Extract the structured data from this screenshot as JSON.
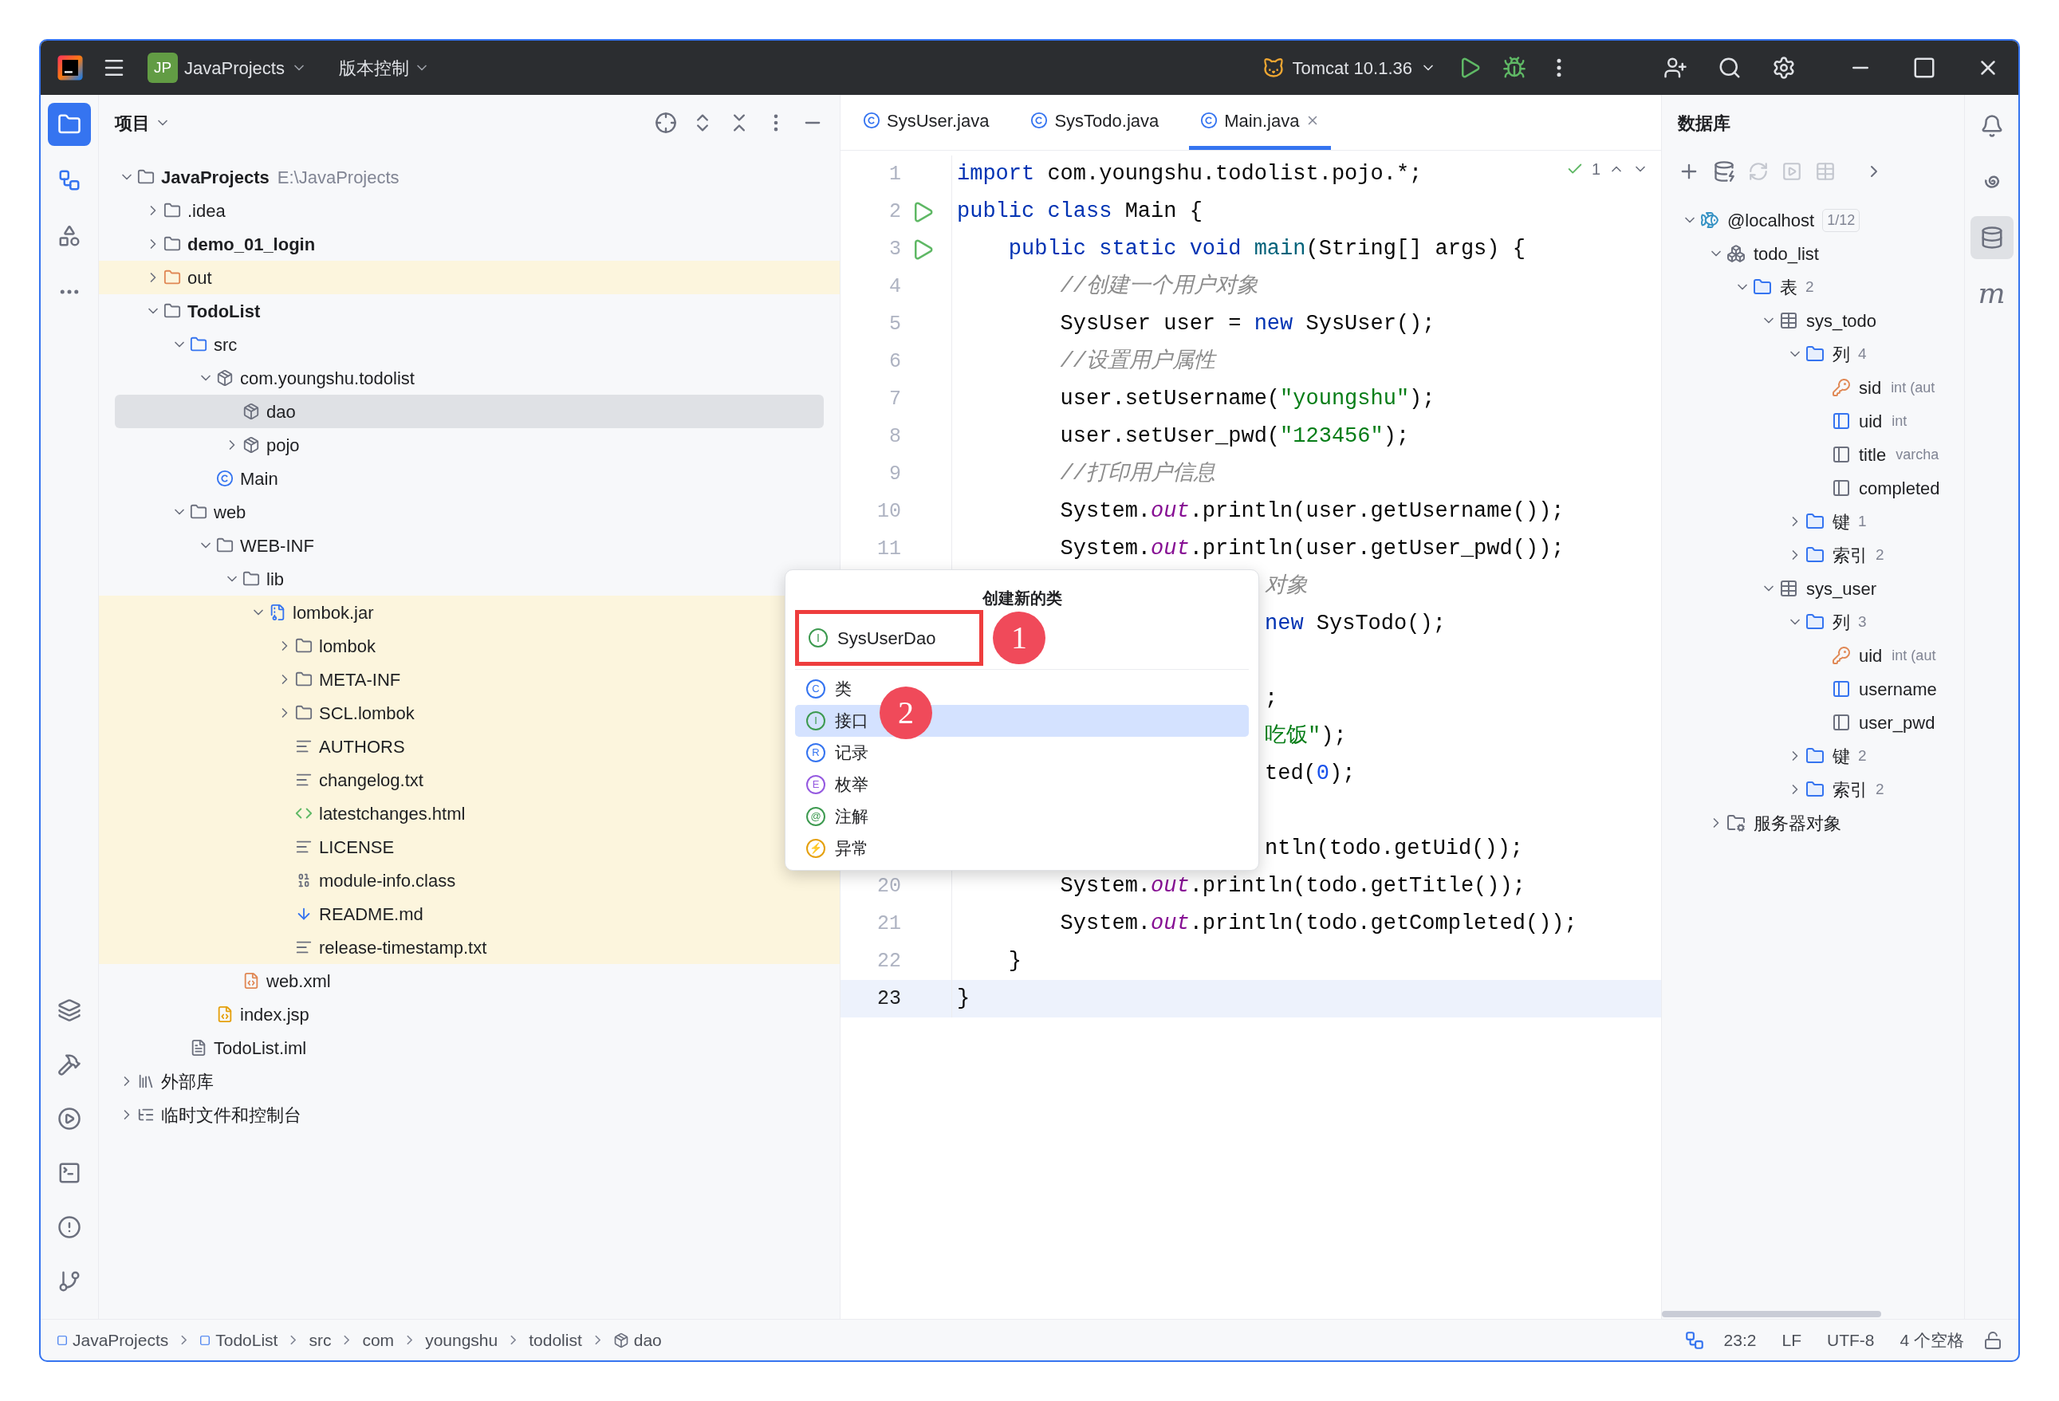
{
  "title_bar": {
    "project_badge": "JP",
    "project": "JavaProjects",
    "vcs": "版本控制",
    "run_config": "Tomcat 10.1.36"
  },
  "project_panel": {
    "title": "项目",
    "tree": [
      {
        "name": "JavaProjects",
        "path": "E:\\JavaProjects",
        "kind": "module",
        "expanded": true,
        "selected": false,
        "highlighted": false,
        "children": [
          {
            "name": ".idea",
            "kind": "folder",
            "expanded": false,
            "selected": false,
            "highlighted": false
          },
          {
            "name": "demo_01_login",
            "kind": "module",
            "expanded": false,
            "selected": false,
            "highlighted": false
          },
          {
            "name": "out",
            "kind": "excluded",
            "expanded": false,
            "selected": false,
            "highlighted": true
          },
          {
            "name": "TodoList",
            "kind": "module",
            "expanded": true,
            "selected": false,
            "highlighted": false,
            "children": [
              {
                "name": "src",
                "kind": "source",
                "expanded": true,
                "selected": false,
                "highlighted": false,
                "children": [
                  {
                    "name": "com.youngshu.todolist",
                    "kind": "package",
                    "expanded": true,
                    "selected": false,
                    "highlighted": false,
                    "children": [
                      {
                        "name": "dao",
                        "kind": "package",
                        "selected": true,
                        "highlighted": false
                      },
                      {
                        "name": "pojo",
                        "kind": "package",
                        "expanded": false,
                        "selected": false,
                        "highlighted": false
                      }
                    ]
                  },
                  {
                    "name": "Main",
                    "kind": "class",
                    "selected": false,
                    "highlighted": false
                  }
                ]
              },
              {
                "name": "web",
                "kind": "folder",
                "expanded": true,
                "selected": false,
                "highlighted": false,
                "children": [
                  {
                    "name": "WEB-INF",
                    "kind": "folder",
                    "expanded": true,
                    "selected": false,
                    "highlighted": false,
                    "children": [
                      {
                        "name": "lib",
                        "kind": "folder",
                        "expanded": true,
                        "selected": false,
                        "highlighted": false,
                        "children": [
                          {
                            "name": "lombok.jar",
                            "kind": "jar",
                            "expanded": true,
                            "selected": false,
                            "highlighted": true,
                            "children": [
                              {
                                "name": "lombok",
                                "kind": "folder",
                                "expanded": false,
                                "selected": false,
                                "highlighted": true
                              },
                              {
                                "name": "META-INF",
                                "kind": "folder",
                                "expanded": false,
                                "selected": false,
                                "highlighted": true
                              },
                              {
                                "name": "SCL.lombok",
                                "kind": "folder",
                                "expanded": false,
                                "selected": false,
                                "highlighted": true
                              },
                              {
                                "name": "AUTHORS",
                                "kind": "text",
                                "selected": false,
                                "highlighted": true
                              },
                              {
                                "name": "changelog.txt",
                                "kind": "text",
                                "selected": false,
                                "highlighted": true
                              },
                              {
                                "name": "latestchanges.html",
                                "kind": "html",
                                "selected": false,
                                "highlighted": true
                              },
                              {
                                "name": "LICENSE",
                                "kind": "text",
                                "selected": false,
                                "highlighted": true
                              },
                              {
                                "name": "module-info.class",
                                "kind": "binary",
                                "selected": false,
                                "highlighted": true
                              },
                              {
                                "name": "README.md",
                                "kind": "markdown",
                                "selected": false,
                                "highlighted": true
                              },
                              {
                                "name": "release-timestamp.txt",
                                "kind": "text",
                                "selected": false,
                                "highlighted": true
                              }
                            ]
                          }
                        ]
                      },
                      {
                        "name": "web.xml",
                        "kind": "xml",
                        "selected": false,
                        "highlighted": false
                      }
                    ]
                  },
                  {
                    "name": "index.jsp",
                    "kind": "jsp",
                    "selected": false,
                    "highlighted": false
                  }
                ]
              },
              {
                "name": "TodoList.iml",
                "kind": "iml",
                "selected": false,
                "highlighted": false
              }
            ]
          }
        ]
      },
      {
        "name": "外部库",
        "kind": "library",
        "expanded": false,
        "selected": false,
        "highlighted": false
      },
      {
        "name": "临时文件和控制台",
        "kind": "scratch",
        "expanded": false,
        "selected": false,
        "highlighted": false
      }
    ]
  },
  "editor": {
    "tabs": [
      {
        "label": "SysUser.java",
        "selected": false
      },
      {
        "label": "SysTodo.java",
        "selected": false
      },
      {
        "label": "Main.java",
        "selected": true
      }
    ],
    "inspection_count": "1",
    "lines": [
      {
        "kind": "full",
        "number": "1",
        "runnable": false,
        "current": false,
        "tokens": [
          {
            "kind": "kw",
            "text": "import"
          },
          {
            "kind": "plain",
            "text": " com.youngshu.todolist.pojo.*;"
          }
        ]
      },
      {
        "kind": "full",
        "number": "2",
        "runnable": true,
        "current": false,
        "tokens": [
          {
            "kind": "kw",
            "text": "public class"
          },
          {
            "kind": "plain",
            "text": " Main {"
          }
        ]
      },
      {
        "kind": "full",
        "number": "3",
        "runnable": true,
        "current": false,
        "tokens": [
          {
            "kind": "kw",
            "text": "    public static void"
          },
          {
            "kind": "method",
            "text": " main"
          },
          {
            "kind": "plain",
            "text": "(String[] args) {"
          }
        ]
      },
      {
        "kind": "full",
        "number": "4",
        "runnable": false,
        "current": false,
        "tokens": [
          {
            "kind": "comment",
            "text": "        //创建一个用户对象"
          }
        ]
      },
      {
        "kind": "full",
        "number": "5",
        "runnable": false,
        "current": false,
        "tokens": [
          {
            "kind": "plain",
            "text": "        SysUser user = "
          },
          {
            "kind": "kw",
            "text": "new"
          },
          {
            "kind": "plain",
            "text": " SysUser();"
          }
        ]
      },
      {
        "kind": "full",
        "number": "6",
        "runnable": false,
        "current": false,
        "tokens": [
          {
            "kind": "comment",
            "text": "        //设置用户属性"
          }
        ]
      },
      {
        "kind": "full",
        "number": "7",
        "runnable": false,
        "current": false,
        "tokens": [
          {
            "kind": "plain",
            "text": "        user.setUsername("
          },
          {
            "kind": "str",
            "text": "\"youngshu\""
          },
          {
            "kind": "plain",
            "text": ");"
          }
        ]
      },
      {
        "kind": "full",
        "number": "8",
        "runnable": false,
        "current": false,
        "tokens": [
          {
            "kind": "plain",
            "text": "        user.setUser_pwd("
          },
          {
            "kind": "str",
            "text": "\"123456\""
          },
          {
            "kind": "plain",
            "text": ");"
          }
        ]
      },
      {
        "kind": "full",
        "number": "9",
        "runnable": false,
        "current": false,
        "tokens": [
          {
            "kind": "comment",
            "text": "        //打印用户信息"
          }
        ]
      },
      {
        "kind": "full",
        "number": "10",
        "runnable": false,
        "current": false,
        "tokens": [
          {
            "kind": "plain",
            "text": "        System."
          },
          {
            "kind": "field",
            "text": "out"
          },
          {
            "kind": "plain",
            "text": ".println(user.getUsername());"
          }
        ]
      },
      {
        "kind": "full",
        "number": "11",
        "runnable": false,
        "current": false,
        "tokens": [
          {
            "kind": "plain",
            "text": "        System."
          },
          {
            "kind": "field",
            "text": "out"
          },
          {
            "kind": "plain",
            "text": ".println(user.getUser_pwd());"
          }
        ]
      },
      {
        "kind": "partial",
        "tokens": [
          {
            "kind": "comment",
            "text": "对象"
          }
        ]
      },
      {
        "kind": "partial",
        "tokens": [
          {
            "kind": "kw",
            "text": "new"
          },
          {
            "kind": "plain",
            "text": " SysTodo();"
          }
        ]
      },
      {
        "kind": "partial"
      },
      {
        "kind": "partial",
        "tokens": [
          {
            "kind": "plain",
            "text": ";"
          }
        ]
      },
      {
        "kind": "partial",
        "tokens": [
          {
            "kind": "str",
            "text": "吃饭\""
          },
          {
            "kind": "plain",
            "text": ");"
          }
        ]
      },
      {
        "kind": "partial",
        "tokens": [
          {
            "kind": "plain",
            "text": "ted("
          },
          {
            "kind": "num",
            "text": "0"
          },
          {
            "kind": "plain",
            "text": ");"
          }
        ]
      },
      {
        "kind": "partial"
      },
      {
        "kind": "partial",
        "tokens": [
          {
            "kind": "plain",
            "text": "ntln(todo.getUid());"
          }
        ]
      },
      {
        "kind": "full",
        "number": "20",
        "runnable": false,
        "current": false,
        "tokens": [
          {
            "kind": "plain",
            "text": "        System."
          },
          {
            "kind": "field",
            "text": "out"
          },
          {
            "kind": "plain",
            "text": ".println(todo.getTitle());"
          }
        ]
      },
      {
        "kind": "full",
        "number": "21",
        "runnable": false,
        "current": false,
        "tokens": [
          {
            "kind": "plain",
            "text": "        System."
          },
          {
            "kind": "field",
            "text": "out"
          },
          {
            "kind": "plain",
            "text": ".println(todo.getCompleted());"
          }
        ]
      },
      {
        "kind": "full",
        "number": "22",
        "runnable": false,
        "current": false,
        "tokens": [
          {
            "kind": "plain",
            "text": "    }"
          }
        ]
      },
      {
        "kind": "full",
        "number": "23",
        "runnable": false,
        "current": true,
        "tokens": [
          {
            "kind": "plain",
            "text": "}"
          }
        ]
      }
    ]
  },
  "popup": {
    "title": "创建新的类",
    "input": {
      "glyph": "I",
      "value": "SysUserDao"
    },
    "items": [
      {
        "glyph": "C",
        "label": "类",
        "color": "#3574f0",
        "selected": false
      },
      {
        "glyph": "I",
        "label": "接口",
        "color": "#3d9a50",
        "selected": true
      },
      {
        "glyph": "R",
        "label": "记录",
        "color": "#3574f0",
        "selected": false
      },
      {
        "glyph": "E",
        "label": "枚举",
        "color": "#955ae0",
        "selected": false
      },
      {
        "glyph": "@",
        "label": "注解",
        "color": "#3d9a50",
        "selected": false
      },
      {
        "glyph": "⚡",
        "label": "异常",
        "color": "#e5a00d",
        "selected": false
      }
    ],
    "markers": [
      "1",
      "2"
    ]
  },
  "database_panel": {
    "title": "数据库",
    "tree": [
      {
        "name": "@localhost",
        "kind": "host",
        "badge": "1/12",
        "expanded": true,
        "children": [
          {
            "name": "todo_list",
            "kind": "schema",
            "expanded": true,
            "children": [
              {
                "name": "表",
                "count": "2",
                "kind": "folder",
                "expanded": true,
                "children": [
                  {
                    "name": "sys_todo",
                    "kind": "table",
                    "expanded": true,
                    "children": [
                      {
                        "name": "列",
                        "count": "4",
                        "kind": "folder",
                        "expanded": true,
                        "children": [
                          {
                            "name": "sid",
                            "detail": "int (aut",
                            "kind": "pk_column"
                          },
                          {
                            "name": "uid",
                            "detail": "int",
                            "kind": "indexed_column"
                          },
                          {
                            "name": "title",
                            "detail": "varcha",
                            "kind": "column"
                          },
                          {
                            "name": "completed",
                            "kind": "column"
                          }
                        ]
                      },
                      {
                        "name": "键",
                        "count": "1",
                        "kind": "folder",
                        "expanded": false
                      },
                      {
                        "name": "索引",
                        "count": "2",
                        "kind": "folder",
                        "expanded": false
                      }
                    ]
                  },
                  {
                    "name": "sys_user",
                    "kind": "table",
                    "expanded": true,
                    "children": [
                      {
                        "name": "列",
                        "count": "3",
                        "kind": "folder",
                        "expanded": true,
                        "children": [
                          {
                            "name": "uid",
                            "detail": "int (aut",
                            "kind": "pk_column"
                          },
                          {
                            "name": "username",
                            "kind": "indexed_column"
                          },
                          {
                            "name": "user_pwd",
                            "kind": "column"
                          }
                        ]
                      },
                      {
                        "name": "键",
                        "count": "2",
                        "kind": "folder",
                        "expanded": false
                      },
                      {
                        "name": "索引",
                        "count": "2",
                        "kind": "folder",
                        "expanded": false
                      }
                    ]
                  }
                ]
              }
            ]
          },
          {
            "name": "服务器对象",
            "kind": "server",
            "expanded": false
          }
        ]
      }
    ]
  },
  "right_toolbar": [
    {
      "kind": "notifications",
      "selected": false
    },
    {
      "kind": "spiral",
      "selected": false
    },
    {
      "kind": "database",
      "selected": true
    },
    {
      "kind": "maven",
      "glyph": "m",
      "selected": false
    }
  ],
  "status_bar": {
    "breadcrumbs": [
      {
        "label": "JavaProjects",
        "kind": "module"
      },
      {
        "label": "TodoList",
        "kind": "module"
      },
      {
        "label": "src",
        "kind": "plain"
      },
      {
        "label": "com",
        "kind": "plain"
      },
      {
        "label": "youngshu",
        "kind": "plain"
      },
      {
        "label": "todolist",
        "kind": "plain"
      },
      {
        "label": "dao",
        "kind": "package"
      }
    ],
    "position": "23:2",
    "line_ending": "LF",
    "encoding": "UTF-8",
    "indent": "4 个空格"
  }
}
